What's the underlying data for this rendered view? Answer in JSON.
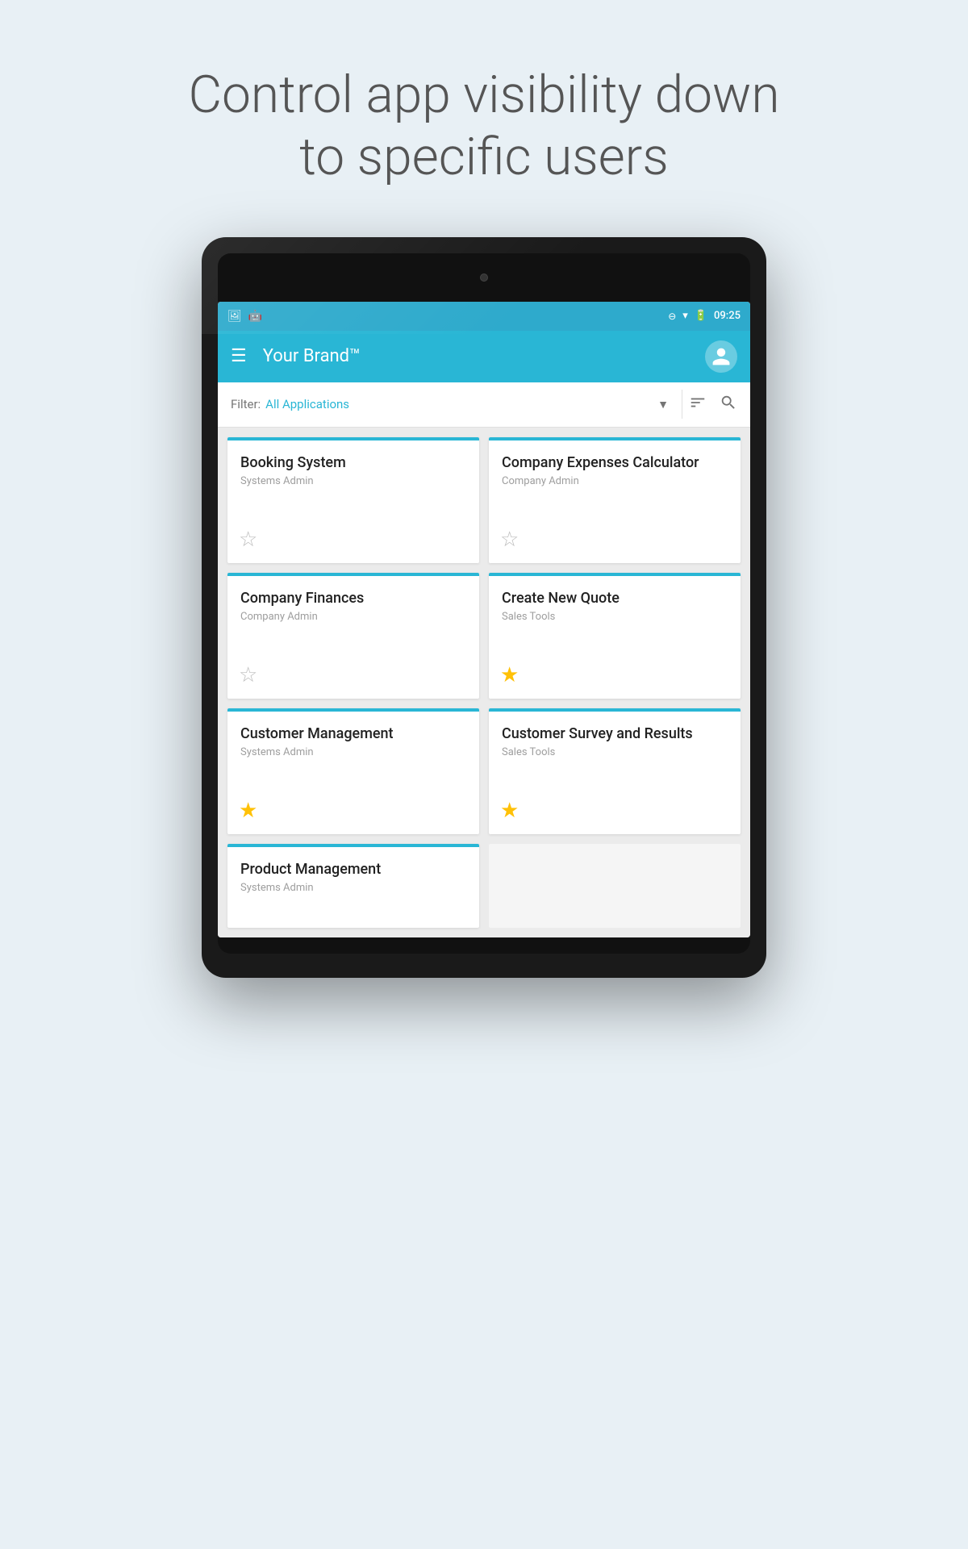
{
  "header": {
    "title_line1": "Control app visibility down",
    "title_line2": "to specific users"
  },
  "status_bar": {
    "time": "09:25",
    "icons_left": [
      "image-icon",
      "android-icon"
    ],
    "icons_right": [
      "minus-icon",
      "wifi-icon",
      "battery-icon"
    ]
  },
  "app_bar": {
    "title": "Your Brand™",
    "menu_icon": "☰",
    "avatar_icon": "👤"
  },
  "filter": {
    "label": "Filter:",
    "value": "All Applications",
    "dropdown_icon": "▼",
    "sort_icon": "≡",
    "search_icon": "🔍"
  },
  "apps": [
    {
      "title": "Booking System",
      "subtitle": "Systems Admin",
      "starred": false
    },
    {
      "title": "Company Expenses Calculator",
      "subtitle": "Company Admin",
      "starred": false
    },
    {
      "title": "Company Finances",
      "subtitle": "Company Admin",
      "starred": false
    },
    {
      "title": "Create New Quote",
      "subtitle": "Sales Tools",
      "starred": true
    },
    {
      "title": "Customer Management",
      "subtitle": "Systems Admin",
      "starred": true
    },
    {
      "title": "Customer Survey and Results",
      "subtitle": "Sales Tools",
      "starred": true
    },
    {
      "title": "Product Management",
      "subtitle": "Systems Admin",
      "starred": false
    }
  ],
  "colors": {
    "accent": "#29b6d5",
    "star_filled": "#FFC107",
    "star_empty": "#bdbdbd"
  }
}
